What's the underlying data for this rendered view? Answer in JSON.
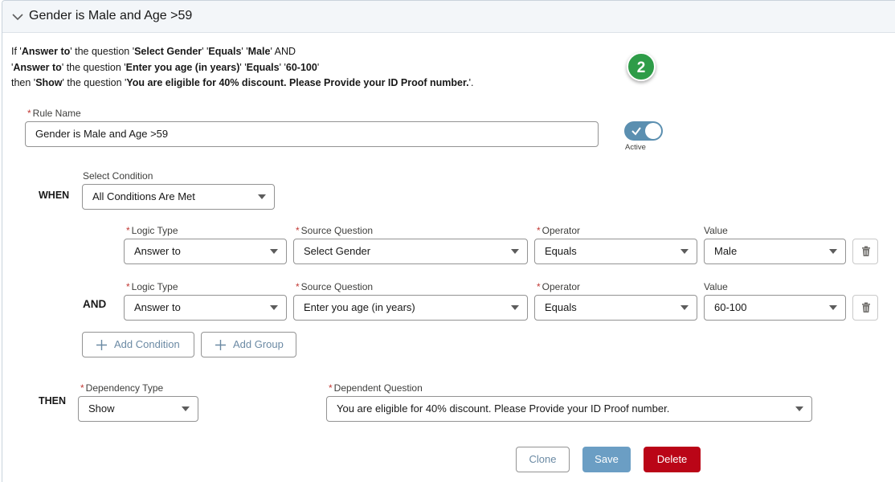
{
  "header": {
    "title": "Gender is Male and Age >59"
  },
  "summary": {
    "line1": {
      "a": "If '",
      "b": "Answer to",
      "c": "' the question '",
      "d": "Select Gender",
      "e": "' '",
      "f": "Equals",
      "g": "' '",
      "h": "Male",
      "i": "' AND"
    },
    "line2": {
      "a": "'",
      "b": "Answer to",
      "c": "' the question '",
      "d": "Enter you age (in years)",
      "e": "' '",
      "f": "Equals",
      "g": "' '",
      "h": "60-100",
      "i": "'"
    },
    "line3": {
      "a": "then '",
      "b": "Show",
      "c": "' the question '",
      "d": "You are eligible for 40% discount. Please Provide your ID Proof number.",
      "e": "'."
    }
  },
  "badge": {
    "number": "2"
  },
  "rule": {
    "label": "Rule Name",
    "value": "Gender is Male and Age >59"
  },
  "toggle": {
    "label": "Active",
    "checked": true
  },
  "when": {
    "keyword": "WHEN",
    "select_label": "Select Condition",
    "select_value": "All Conditions Are Met"
  },
  "conditions": [
    {
      "prefix": "",
      "logic_type_label": "Logic Type",
      "logic_type": "Answer to",
      "source_label": "Source Question",
      "source": "Select Gender",
      "operator_label": "Operator",
      "operator": "Equals",
      "value_label": "Value",
      "value": "Male"
    },
    {
      "prefix": "AND",
      "logic_type_label": "Logic Type",
      "logic_type": "Answer to",
      "source_label": "Source Question",
      "source": "Enter you age (in years)",
      "operator_label": "Operator",
      "operator": "Equals",
      "value_label": "Value",
      "value": "60-100"
    }
  ],
  "buttons": {
    "add_condition": "Add Condition",
    "add_group": "Add Group",
    "clone": "Clone",
    "save": "Save",
    "delete": "Delete"
  },
  "then": {
    "keyword": "THEN",
    "dependency_label": "Dependency Type",
    "dependency_value": "Show",
    "dependent_label": "Dependent Question",
    "dependent_value": "You are eligible for 40% discount. Please Provide your ID Proof number."
  },
  "colors": {
    "accent": "#5b8fb0",
    "delete": "#ba0517",
    "badge": "#2e9c48",
    "required": "#c23934"
  }
}
